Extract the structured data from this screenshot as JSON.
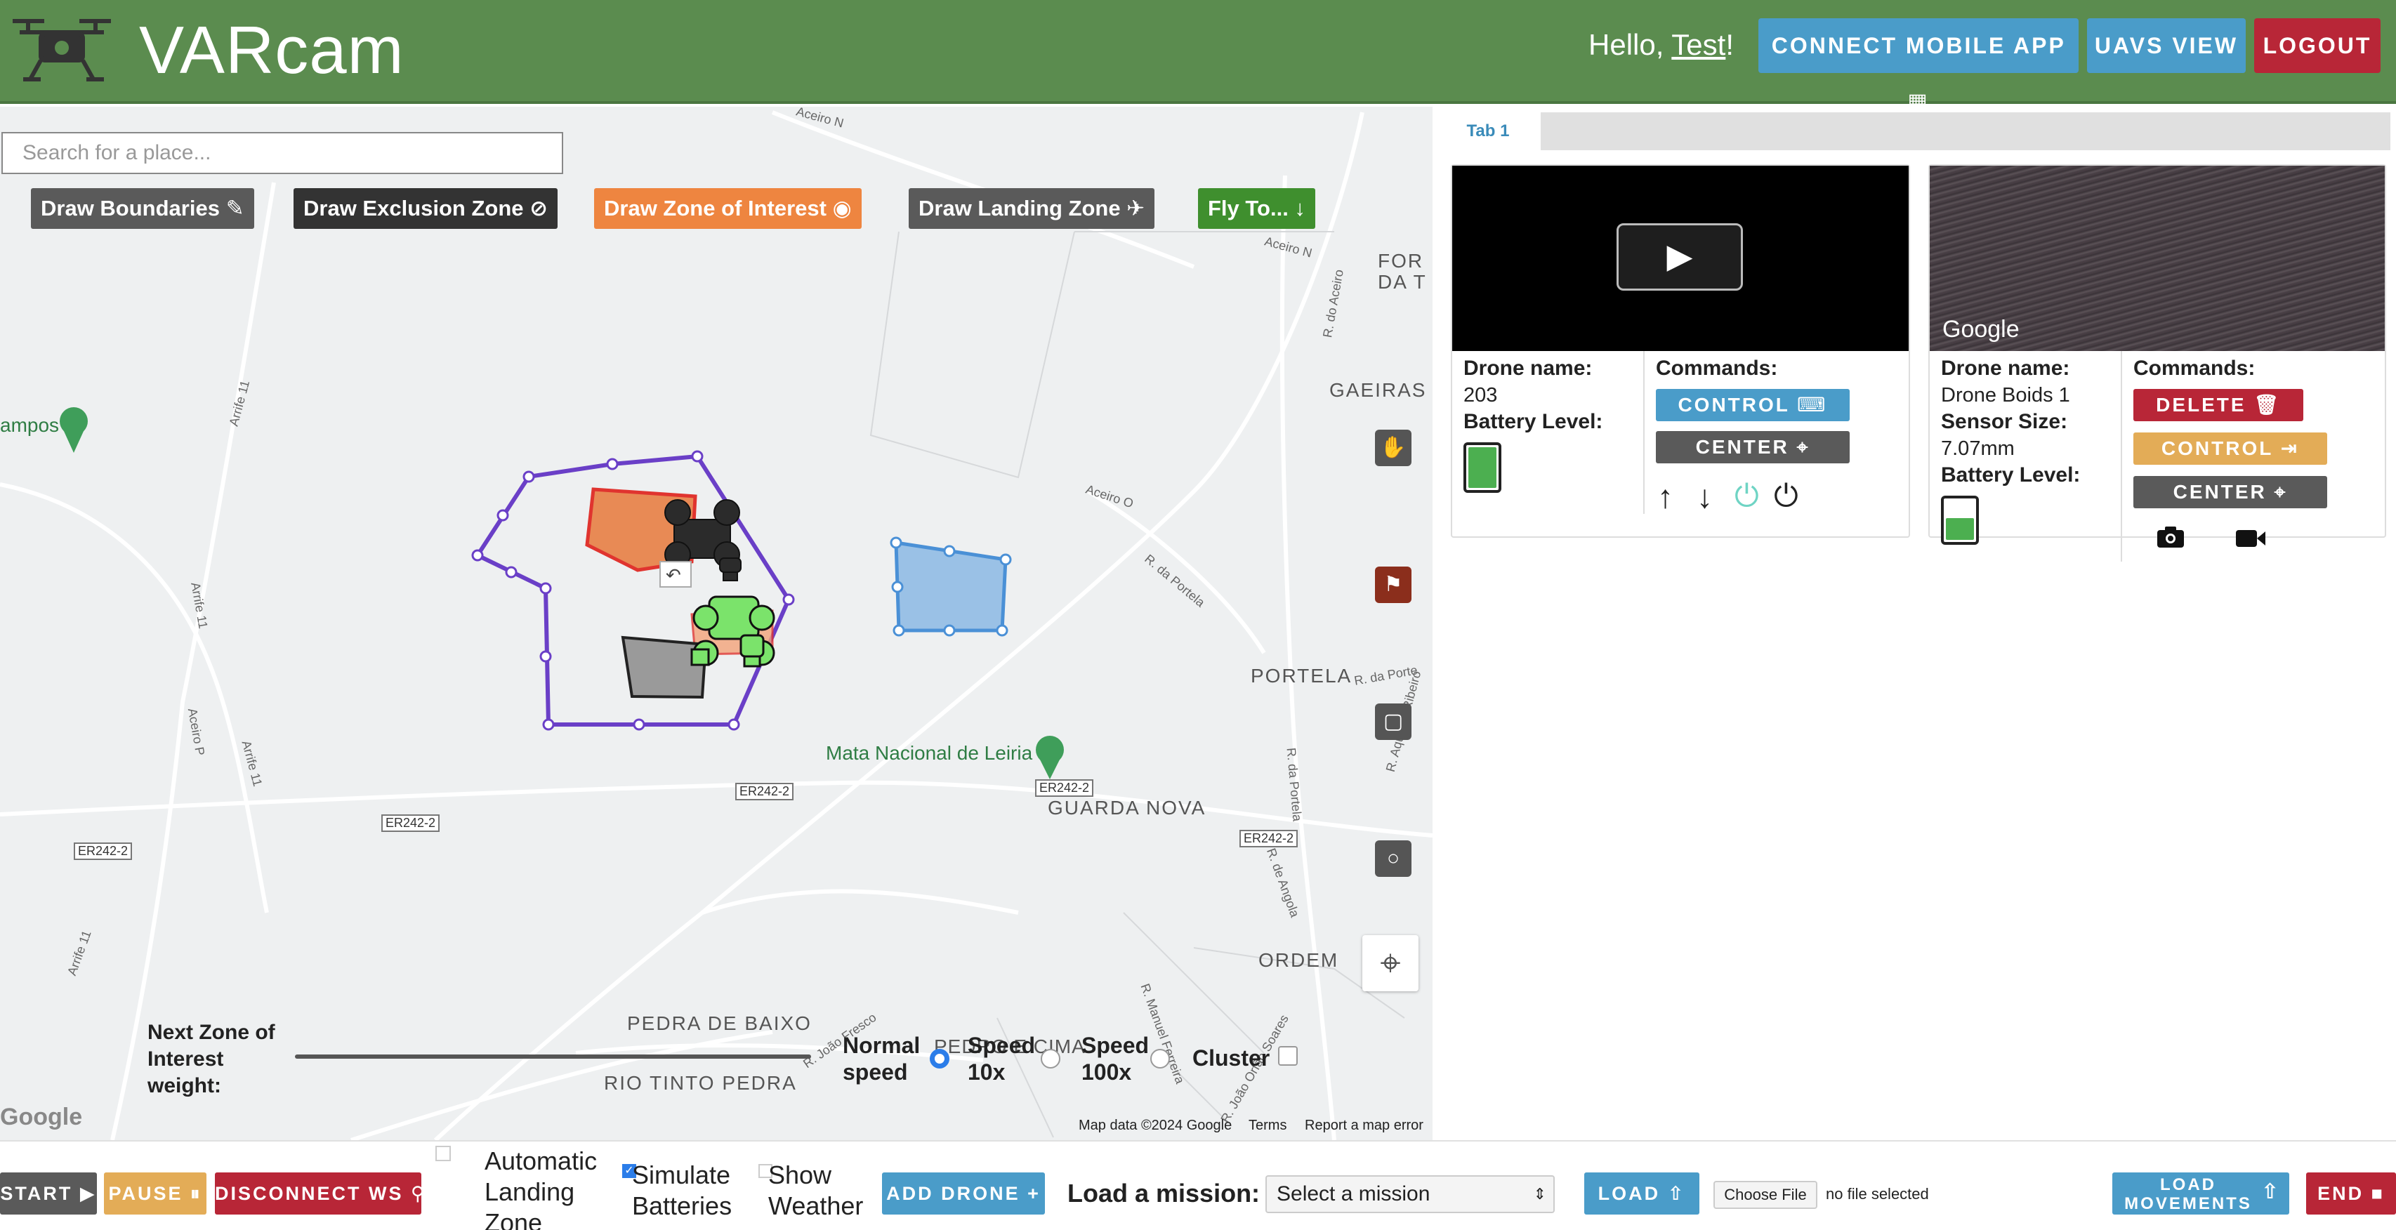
{
  "header": {
    "title": "VARcam",
    "greeting_prefix": "Hello, ",
    "user": "Test",
    "greeting_suffix": "!",
    "connect_label": "CONNECT MOBILE APP",
    "uavs_label": "UAVS VIEW",
    "logout_label": "LOGOUT"
  },
  "map": {
    "search_placeholder": "Search for a place...",
    "draw_boundaries": "Draw Boundaries",
    "draw_exclusion": "Draw Exclusion Zone",
    "draw_interest": "Draw Zone of Interest",
    "draw_landing": "Draw Landing Zone",
    "fly_to": "Fly To...",
    "places": {
      "gaeiras": "GAEIRAS",
      "portela": "PORTELA",
      "guarda_nova": "GUARDA NOVA",
      "ordem": "ORDEM",
      "pedra_de_baixo": "PEDRA DE BAIXO",
      "rio_tinto": "RIO TINTO PEDRA",
      "for_da_t": "FOR\nDA T",
      "campos": "ampos",
      "mata": "Mata Nacional de Leiria"
    },
    "roads": {
      "aceiro_n_top": "Aceiro N",
      "aceiro_n": "Aceiro N",
      "aceiro_o": "Aceiro O",
      "r_portela": "R. da Portela",
      "r_portela2": "R. da Portela",
      "r_aceiro": "R. do Aceiro",
      "arrife_11a": "Arrife 11",
      "arrife_11b": "Arrife 11",
      "arrife_11c": "Arrife 11",
      "arrife_11d": "Arrife 11",
      "aceiro_p": "Aceiro P",
      "r_angola": "R. de Angola",
      "r_porte": "R. da Porte",
      "r_aquilino": "R. Aquilino Ribeiro",
      "r_joao": "R. João Fresco",
      "r_manuel": "R. Manuel Ferreira",
      "r_orfao": "R. João Orfão Soares"
    },
    "shields": [
      "ER242-2",
      "ER242-2",
      "ER242-2",
      "ER242-2",
      "ER242-2"
    ],
    "next_zone_label": "Next Zone of Interest weight:",
    "speed_normal": "Normal speed",
    "speed_10x": "Speed 10x",
    "speed_100x": "Speed 100x",
    "cluster": "Cluster",
    "pedro_cima": "PEDRO E CIMA",
    "map_data": "Map data ©2024 Google",
    "terms": "Terms",
    "report": "Report a map error",
    "google": "Google"
  },
  "panel": {
    "tab_label": "Tab 1",
    "drone1": {
      "name_label": "Drone name:",
      "name": "203",
      "battery_label": "Battery Level:",
      "battery_level": 1.0,
      "commands_label": "Commands:",
      "control": "CONTROL",
      "center": "CENTER"
    },
    "drone2": {
      "name_label": "Drone name:",
      "name": "Drone Boids 1",
      "sensor_label": "Sensor Size:",
      "sensor": "7.07mm",
      "battery_label": "Battery Level:",
      "battery_level": 0.6,
      "commands_label": "Commands:",
      "delete": "DELETE",
      "control": "CONTROL",
      "center": "CENTER",
      "google": "Google"
    }
  },
  "bottom": {
    "start": "START",
    "pause": "PAUSE",
    "disconnect": "DISCONNECT WS",
    "auto_landing": "Automatic Landing Zone",
    "simulate": "Simulate Batteries",
    "show_weather": "Show Weather",
    "add_drone": "ADD DRONE",
    "load_mission_label": "Load a mission:",
    "select_mission": "Select a mission",
    "load": "LOAD",
    "choose_file": "Choose File",
    "no_file": "no file selected",
    "load_movements": "LOAD MOVEMENTS",
    "end": "END"
  },
  "colors": {
    "header": "#5b8c4f",
    "blue_button": "#4a9cc9",
    "red_button": "#b82637",
    "orange_button": "#ee8540",
    "gray_button": "#5a5a5a",
    "green_button": "#3f8f2e",
    "yellow_button": "#e3ac57",
    "boundary": "#6a3fc7"
  }
}
